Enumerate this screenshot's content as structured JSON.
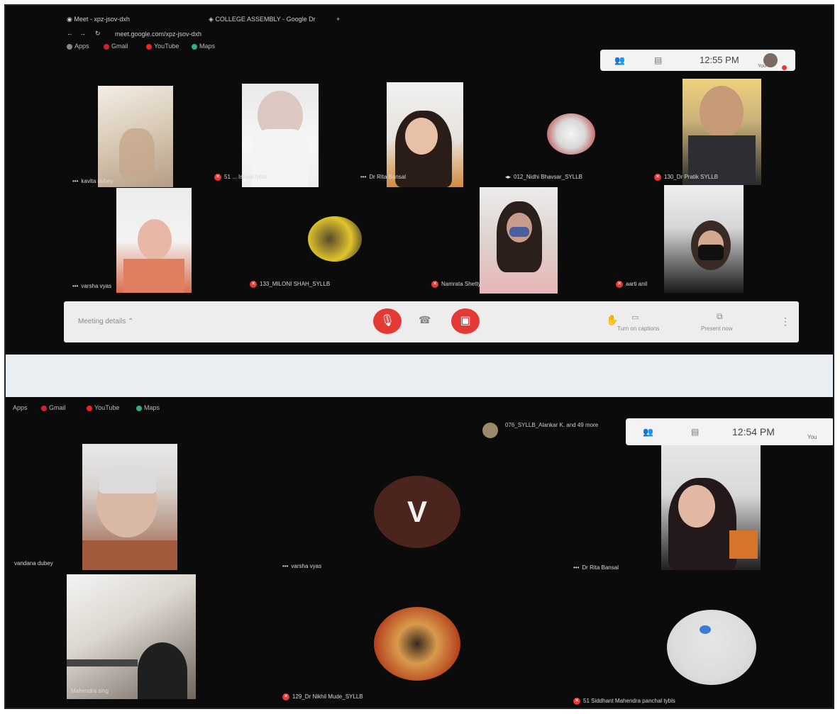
{
  "browser": {
    "tabs": [
      "Meet - xpz-jsov-dxh",
      "COLLEGE ASSEMBLY - Google Dr"
    ],
    "address": "meet.google.com/xpz-jsov-dxh",
    "bookmarks": [
      "Apps",
      "Gmail",
      "YouTube",
      "Maps"
    ]
  },
  "top_meeting": {
    "time": "12:55 PM",
    "you_label": "You",
    "participants": [
      {
        "label": "kavita dubey"
      },
      {
        "label": "51 ... Ishaal tybls"
      },
      {
        "label": "Dr Rita Bansal"
      },
      {
        "label": "012_Nidhi Bhavsar_SYLLB"
      },
      {
        "label": "130_Dr Pratik SYLLB"
      },
      {
        "label": "varsha vyas"
      },
      {
        "label": "133_MILONI SHAH_SYLLB"
      },
      {
        "label": "Namrata Shetty"
      },
      {
        "label": "aarti anil"
      }
    ],
    "controls": {
      "meeting_details": "Meeting details",
      "captions": "Turn on captions",
      "present": "Present now"
    }
  },
  "bottom_meeting": {
    "time": "12:54 PM",
    "you_label": "You",
    "presenting": "076_SYLLB_Alankar K. and 49 more",
    "avatar_letter": "V",
    "participants": [
      {
        "label": "vandana dubey"
      },
      {
        "label": "varsha vyas"
      },
      {
        "label": "Dr Rita Bansal"
      },
      {
        "label": "Mahendra sing"
      },
      {
        "label": "129_Dr Nikhil Mude_SYLLB"
      },
      {
        "label": "51 Siddhant Mahendra panchal tybls"
      }
    ],
    "bookmarks": [
      "Apps",
      "Gmail",
      "YouTube",
      "Maps"
    ]
  },
  "colors": {
    "mic_off": "#e53935",
    "meet_background": "#0b0b0b",
    "controls_bar": "#ededed"
  }
}
